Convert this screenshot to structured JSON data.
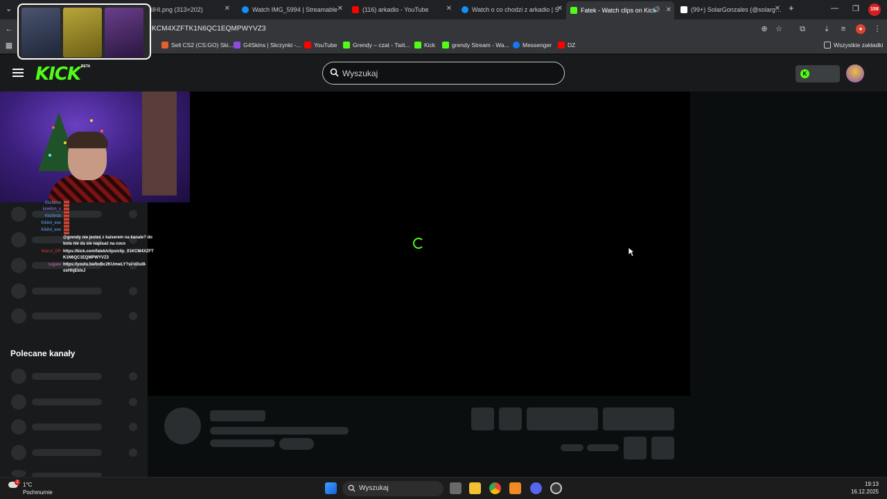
{
  "browser": {
    "tabs": [
      {
        "title": "iIHI.png (313×202)",
        "favicon_color": "#5f6368"
      },
      {
        "title": "Watch IMG_5994 | Streamable",
        "favicon_color": "#0f90fa"
      },
      {
        "title": "(116) arkadio - YouTube",
        "favicon_color": "#ff0000"
      },
      {
        "title": "Watch o co chodzi z arkadio | S",
        "favicon_color": "#0f90fa"
      },
      {
        "title": "Fatek - Watch clips on Kick",
        "favicon_color": "#53fc18"
      },
      {
        "title": "(99+) SolarGonzales (@solarg…",
        "favicon_color": "#ffffff"
      }
    ],
    "url": "KCM4XZFTK1N6QC1EQMPWYVZ3",
    "bookmarks": [
      {
        "label": "Sell CS2 (CS:GO) Ski...",
        "color": "#e0612c"
      },
      {
        "label": "G4Skins | Skrzynki -...",
        "color": "#8e4be0"
      },
      {
        "label": "YouTube",
        "color": "#ff0000"
      },
      {
        "label": "Grendy – czat - Twit...",
        "color": "#53fc18"
      },
      {
        "label": "Kick",
        "color": "#53fc18"
      },
      {
        "label": "grendy Stream - Wa...",
        "color": "#53fc18"
      },
      {
        "label": "Messenger",
        "color": "#1877f2"
      },
      {
        "label": "DZ",
        "color": "#ff0000"
      }
    ],
    "all_bookmarks": "Wszystkie zakładki",
    "profile_badge": "158"
  },
  "kick": {
    "logo": "KICK",
    "beta": "BETA",
    "search_placeholder": "Wyszukaj",
    "brand_color": "#53fc18",
    "recommended_heading": "Polecane kanały"
  },
  "chat": [
    {
      "user": "Kiichiroo",
      "color": "#5fa8ff",
      "msg": ""
    },
    {
      "user": "luiwiton_x",
      "color": "#9a7cff",
      "msg": ""
    },
    {
      "user": "Kiichiroo",
      "color": "#5fa8ff",
      "msg": ""
    },
    {
      "user": "Kikilol_exe",
      "color": "#5fa8ff",
      "msg": ""
    },
    {
      "user": "Kikilol_exe",
      "color": "#5fa8ff",
      "msg": ""
    },
    {
      "user": "",
      "color": "#d23c3c",
      "msg": "@grendy nie jesteś z kaiserem na kanale? do"
    },
    {
      "user": "",
      "color": "#d23c3c",
      "msg": "bota nie da sie napisać na coco"
    },
    {
      "user": "Manul_DR",
      "color": "#d23c3c",
      "msg": "https://kick.com/fatek/clips/clip_01KCM4XZFT"
    },
    {
      "user": "",
      "color": "#d23c3c",
      "msg": "K1N6QC1EQMPWYVZ3"
    },
    {
      "user": "sugare",
      "color": "#d86aa8",
      "msg": "https://youtu.be/bvBc2KUmwLY?si=d3ul8-"
    },
    {
      "user": "",
      "color": "#d86aa8",
      "msg": "oxHhjEkIxJ"
    }
  ],
  "taskbar": {
    "temperature": "1°C",
    "weather": "Pochmurnie",
    "weather_badge": "2",
    "search_placeholder": "Wyszukaj",
    "time": "19:13",
    "date": "16.12.2025"
  }
}
